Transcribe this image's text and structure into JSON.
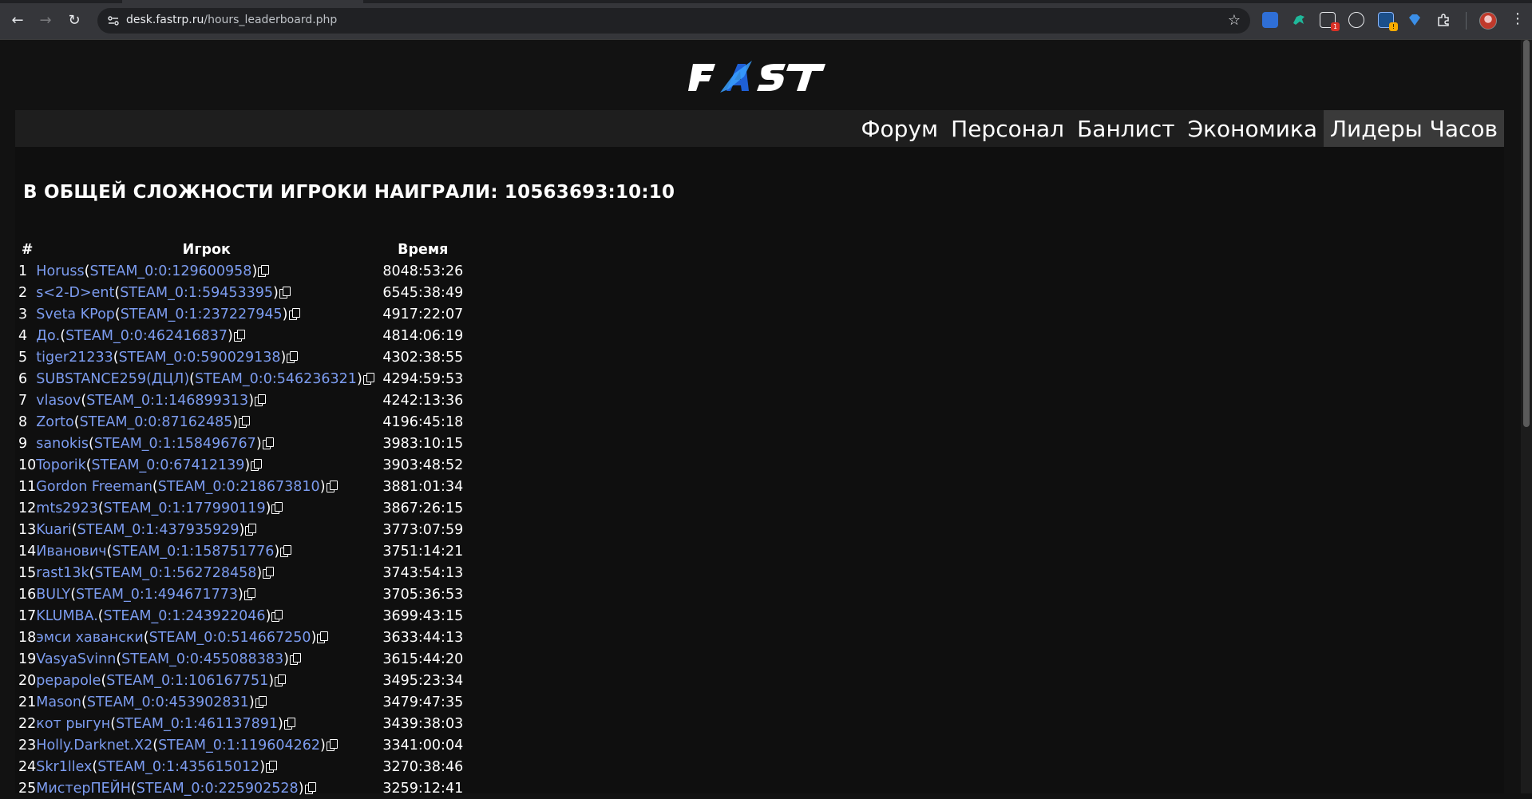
{
  "browser": {
    "url_host": "desk.fastrp.ru",
    "url_path": "/hours_leaderboard.php",
    "extension_badges": [
      "1",
      "!"
    ]
  },
  "site": {
    "logo_text": "FAST",
    "nav": [
      {
        "label": "Форум"
      },
      {
        "label": "Персонал"
      },
      {
        "label": "Банлист"
      },
      {
        "label": "Экономика"
      },
      {
        "label": "Лидеры Часов"
      }
    ]
  },
  "main": {
    "total_label": "В ОБЩЕЙ СЛОЖНОСТИ ИГРОКИ НАИГРАЛИ: 10563693:10:10",
    "columns": [
      "#",
      "Игрок",
      "Время"
    ],
    "rows": [
      {
        "rank": "1",
        "name": "Horuss",
        "steam": "STEAM_0:0:129600958",
        "time": "8048:53:26"
      },
      {
        "rank": "2",
        "name": "s<2-D>ent",
        "steam": "STEAM_0:1:59453395",
        "time": "6545:38:49"
      },
      {
        "rank": "3",
        "name": "Sveta KPop",
        "steam": "STEAM_0:1:237227945",
        "time": "4917:22:07"
      },
      {
        "rank": "4",
        "name": "До.",
        "steam": "STEAM_0:0:462416837",
        "time": "4814:06:19"
      },
      {
        "rank": "5",
        "name": "tiger21233",
        "steam": "STEAM_0:0:590029138",
        "time": "4302:38:55"
      },
      {
        "rank": "6",
        "name": "SUBSTANCE259(ДЦЛ)",
        "steam": "STEAM_0:0:546236321",
        "time": "4294:59:53"
      },
      {
        "rank": "7",
        "name": "vlasov",
        "steam": "STEAM_0:1:146899313",
        "time": "4242:13:36"
      },
      {
        "rank": "8",
        "name": "Zorto",
        "steam": "STEAM_0:0:87162485",
        "time": "4196:45:18"
      },
      {
        "rank": "9",
        "name": "sanokis",
        "steam": "STEAM_0:1:158496767",
        "time": "3983:10:15"
      },
      {
        "rank": "10",
        "name": "Toporik",
        "steam": "STEAM_0:0:67412139",
        "time": "3903:48:52"
      },
      {
        "rank": "11",
        "name": "Gordon Freeman",
        "steam": "STEAM_0:0:218673810",
        "time": "3881:01:34"
      },
      {
        "rank": "12",
        "name": "mts2923",
        "steam": "STEAM_0:1:177990119",
        "time": "3867:26:15"
      },
      {
        "rank": "13",
        "name": "Kuari",
        "steam": "STEAM_0:1:437935929",
        "time": "3773:07:59"
      },
      {
        "rank": "14",
        "name": "Иванович",
        "steam": "STEAM_0:1:158751776",
        "time": "3751:14:21"
      },
      {
        "rank": "15",
        "name": "rast13k",
        "steam": "STEAM_0:1:562728458",
        "time": "3743:54:13"
      },
      {
        "rank": "16",
        "name": "BULY",
        "steam": "STEAM_0:1:494671773",
        "time": "3705:36:53"
      },
      {
        "rank": "17",
        "name": "KLUMBA.",
        "steam": "STEAM_0:1:243922046",
        "time": "3699:43:15"
      },
      {
        "rank": "18",
        "name": "эмси хавански",
        "steam": "STEAM_0:0:514667250",
        "time": "3633:44:13"
      },
      {
        "rank": "19",
        "name": "VasyaSvinn",
        "steam": "STEAM_0:0:455088383",
        "time": "3615:44:20"
      },
      {
        "rank": "20",
        "name": "pepapole",
        "steam": "STEAM_0:1:106167751",
        "time": "3495:23:34"
      },
      {
        "rank": "21",
        "name": "Mason",
        "steam": "STEAM_0:0:453902831",
        "time": "3479:47:35"
      },
      {
        "rank": "22",
        "name": "кот рыгун",
        "steam": "STEAM_0:1:461137891",
        "time": "3439:38:03"
      },
      {
        "rank": "23",
        "name": "Holly.Darknet.X2",
        "steam": "STEAM_0:1:119604262",
        "time": "3341:00:04"
      },
      {
        "rank": "24",
        "name": "Skr1llex",
        "steam": "STEAM_0:1:435615012",
        "time": "3270:38:46"
      },
      {
        "rank": "25",
        "name": "МистерПЕЙН",
        "steam": "STEAM_0:0:225902528",
        "time": "3259:12:41"
      }
    ]
  }
}
